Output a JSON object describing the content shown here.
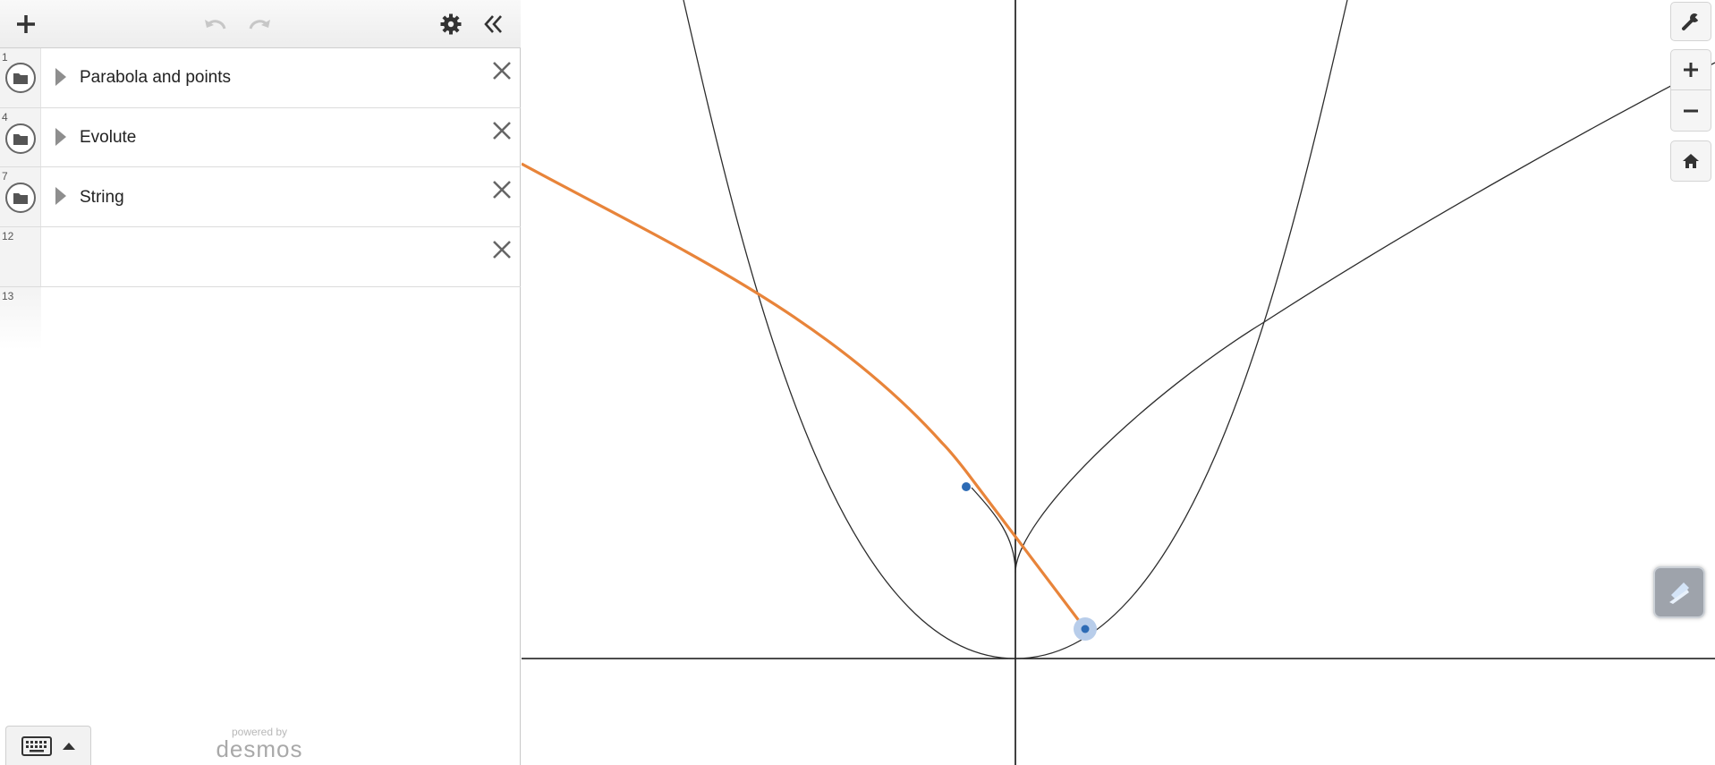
{
  "header": {
    "add_icon": "plus-icon",
    "undo_icon": "undo-icon",
    "redo_icon": "redo-icon",
    "settings_icon": "gear-icon",
    "collapse_icon": "double-chevron-left-icon"
  },
  "expressions": [
    {
      "number": "1",
      "label": "Parabola and points",
      "type": "folder"
    },
    {
      "number": "4",
      "label": "Evolute",
      "type": "folder"
    },
    {
      "number": "7",
      "label": "String",
      "type": "folder"
    },
    {
      "number": "12",
      "label": "",
      "type": "expression"
    },
    {
      "number": "13",
      "label": "",
      "type": "new-expression"
    }
  ],
  "footer": {
    "powered_by": "powered by",
    "brand": "desmos"
  },
  "graph_controls": {
    "wrench_icon": "wrench-icon",
    "zoom_in_icon": "plus-icon",
    "zoom_out_icon": "minus-icon",
    "home_icon": "home-icon",
    "sketch_icon": "sketch-icon"
  },
  "colors": {
    "string_curve": "#e8843a",
    "curve": "#2d2d2d",
    "point": "#2d6bb5",
    "point_highlight": "#b8cdea"
  }
}
